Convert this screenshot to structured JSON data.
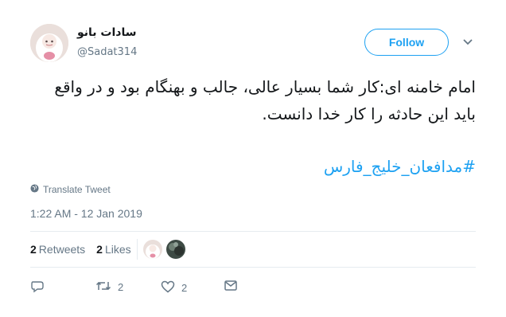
{
  "user": {
    "display_name": "سادات بانو",
    "handle": "@Sadat314"
  },
  "follow_label": "Follow",
  "tweet": {
    "text": "امام خامنه ای:کار شما بسیار عالی، جالب و بهنگام بود و در واقع باید این حادثه را کار خدا دانست.",
    "hashtag": "#مدافعان_خلیج_فارس"
  },
  "translate_label": "Translate Tweet",
  "timestamp": "1:22 AM - 12 Jan 2019",
  "stats": {
    "retweets_count": "2",
    "retweets_label": "Retweets",
    "likes_count": "2",
    "likes_label": "Likes"
  },
  "actions": {
    "retweet_count": "2",
    "like_count": "2"
  },
  "colors": {
    "accent": "#1da1f2",
    "muted": "#657786",
    "divider": "#e6ecf0"
  }
}
